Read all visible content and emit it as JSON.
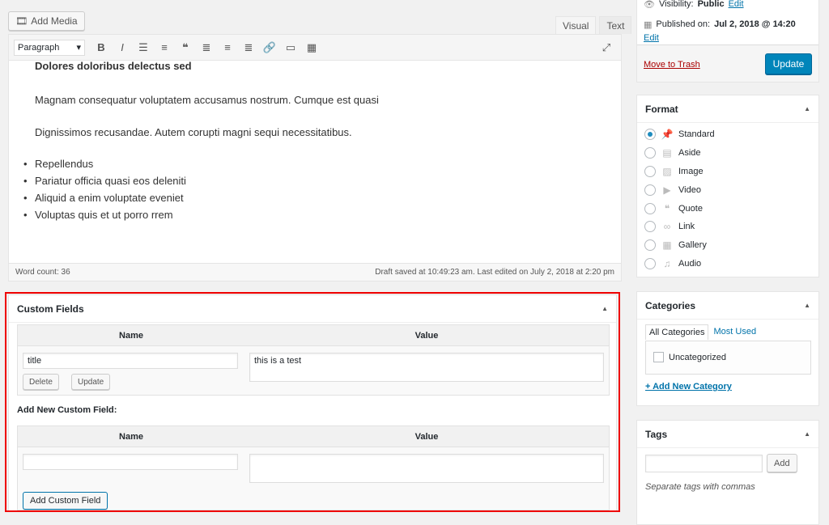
{
  "media": {
    "add_media_label": "Add Media"
  },
  "editor": {
    "tabs": [
      "Visual",
      "Text"
    ],
    "format_select": "Paragraph",
    "heading": "Dolores doloribus delectus sed",
    "paragraphs": [
      "Magnam consequatur voluptatem accusamus nostrum. Cumque est quasi",
      "Dignissimos recusandae. Autem corupti magni sequi necessitatibus."
    ],
    "bullets": [
      "Repellendus",
      "Pariatur officia quasi eos deleniti",
      "Aliquid a enim voluptate eveniet",
      "Voluptas quis et ut porro rrem"
    ],
    "word_count": "Word count: 36",
    "draft_status": "Draft saved at 10:49:23 am. Last edited on July 2, 2018 at 2:20 pm"
  },
  "custom_fields": {
    "title": "Custom Fields",
    "col_name": "Name",
    "col_value": "Value",
    "existing": {
      "name": "title",
      "value": "this is a test"
    },
    "delete_label": "Delete",
    "update_label": "Update",
    "add_new_title": "Add New Custom Field:",
    "add_button": "Add Custom Field"
  },
  "publish": {
    "visibility_label": "Visibility:",
    "visibility_value": "Public",
    "edit": "Edit",
    "published_label": "Published on:",
    "published_value": "Jul 2, 2018 @ 14:20",
    "trash": "Move to Trash",
    "update": "Update"
  },
  "format": {
    "title": "Format",
    "options": [
      {
        "label": "Standard",
        "icon": "pin-icon",
        "selected": true
      },
      {
        "label": "Aside",
        "icon": "aside-icon",
        "selected": false
      },
      {
        "label": "Image",
        "icon": "image-icon",
        "selected": false
      },
      {
        "label": "Video",
        "icon": "video-icon",
        "selected": false
      },
      {
        "label": "Quote",
        "icon": "quote-icon",
        "selected": false
      },
      {
        "label": "Link",
        "icon": "link-icon",
        "selected": false
      },
      {
        "label": "Gallery",
        "icon": "gallery-icon",
        "selected": false
      },
      {
        "label": "Audio",
        "icon": "audio-icon",
        "selected": false
      }
    ]
  },
  "categories": {
    "title": "Categories",
    "tab_all": "All Categories",
    "tab_used": "Most Used",
    "items": [
      "Uncategorized"
    ],
    "add_new": "+ Add New Category"
  },
  "tags": {
    "title": "Tags",
    "add": "Add",
    "help": "Separate tags with commas"
  }
}
